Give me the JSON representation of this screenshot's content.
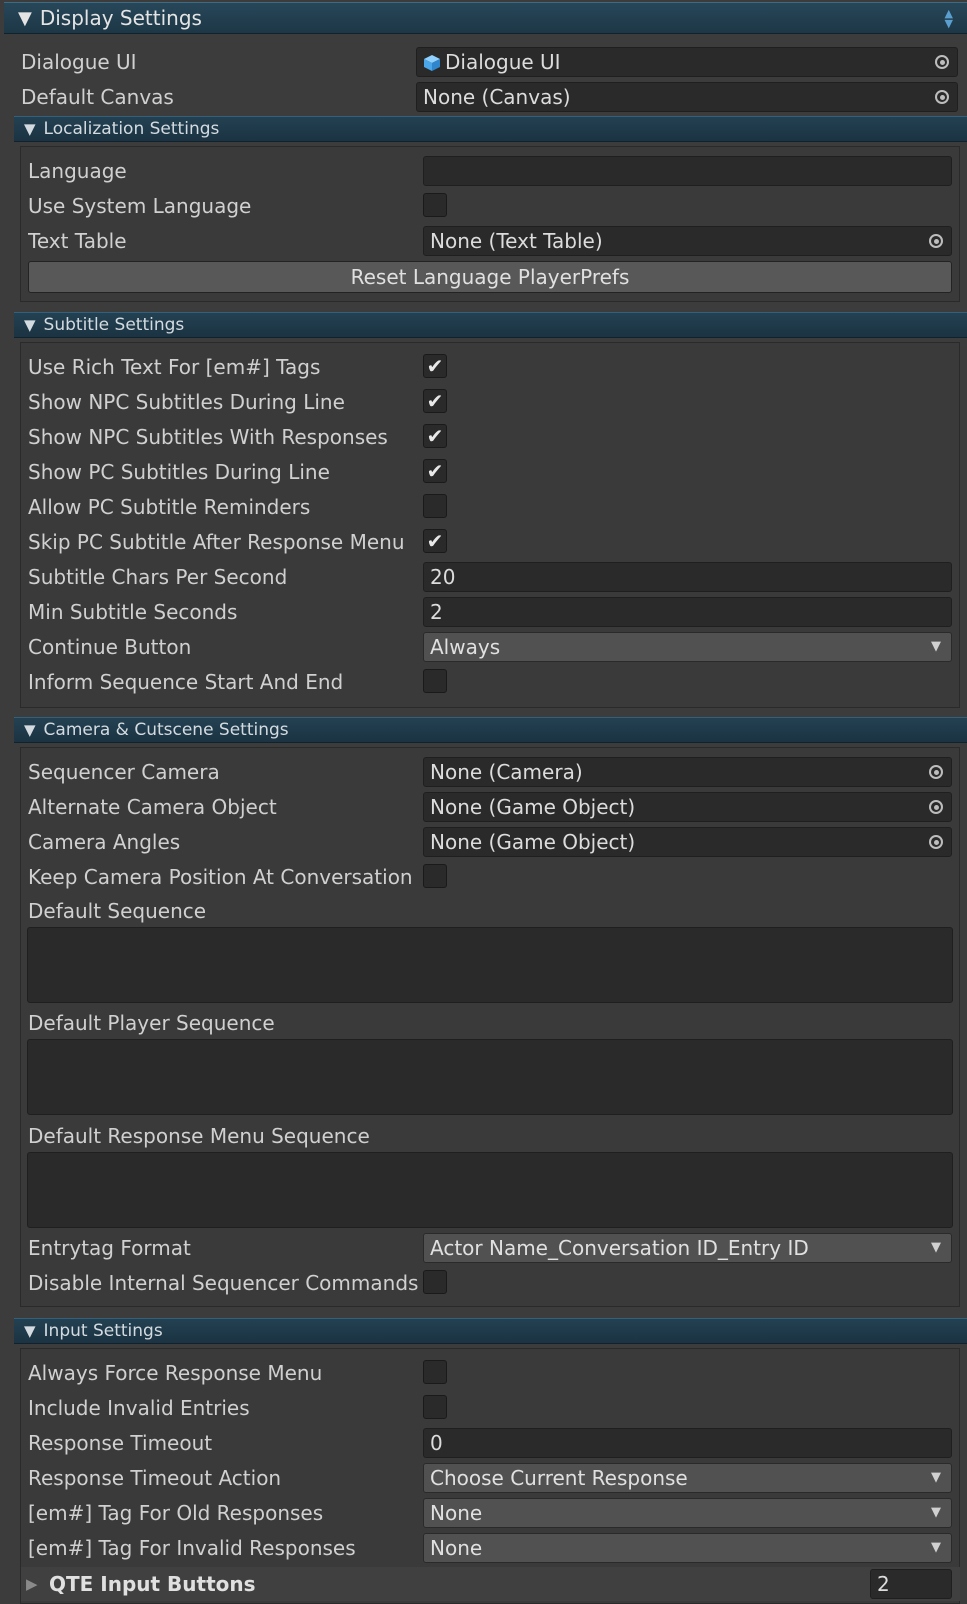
{
  "display_header": "Display Settings",
  "top": {
    "dialogue_ui_label": "Dialogue UI",
    "dialogue_ui_value": "Dialogue UI",
    "default_canvas_label": "Default Canvas",
    "default_canvas_value": "None (Canvas)"
  },
  "localization": {
    "header": "Localization Settings",
    "language_label": "Language",
    "language_value": "",
    "use_system_language_label": "Use System Language",
    "use_system_language": false,
    "text_table_label": "Text Table",
    "text_table_value": "None (Text Table)",
    "reset_button": "Reset Language PlayerPrefs"
  },
  "subtitle": {
    "header": "Subtitle Settings",
    "rows": [
      {
        "label": "Use Rich Text For [em#] Tags",
        "checked": true
      },
      {
        "label": "Show NPC Subtitles During Line",
        "checked": true
      },
      {
        "label": "Show NPC Subtitles With Responses",
        "checked": true
      },
      {
        "label": "Show PC Subtitles During Line",
        "checked": true
      },
      {
        "label": "Allow PC Subtitle Reminders",
        "checked": false
      },
      {
        "label": "Skip PC Subtitle After Response Menu",
        "checked": true
      }
    ],
    "chars_per_second_label": "Subtitle Chars Per Second",
    "chars_per_second": "20",
    "min_seconds_label": "Min Subtitle Seconds",
    "min_seconds": "2",
    "continue_button_label": "Continue Button",
    "continue_button_value": "Always",
    "inform_sequence_label": "Inform Sequence Start And End",
    "inform_sequence": false
  },
  "camera": {
    "header": "Camera & Cutscene Settings",
    "sequencer_camera_label": "Sequencer Camera",
    "sequencer_camera_value": "None (Camera)",
    "alternate_camera_label": "Alternate Camera Object",
    "alternate_camera_value": "None (Game Object)",
    "camera_angles_label": "Camera Angles",
    "camera_angles_value": "None (Game Object)",
    "keep_camera_label": "Keep Camera Position At Conversation End",
    "keep_camera": false,
    "default_sequence_label": "Default Sequence",
    "default_sequence_value": "",
    "default_player_sequence_label": "Default Player Sequence",
    "default_player_sequence_value": "",
    "default_response_menu_sequence_label": "Default Response Menu Sequence",
    "default_response_menu_sequence_value": "",
    "entrytag_format_label": "Entrytag Format",
    "entrytag_format_value": "Actor Name_Conversation ID_Entry ID",
    "disable_internal_label": "Disable Internal Sequencer Commands",
    "disable_internal": false
  },
  "input": {
    "header": "Input Settings",
    "always_force_label": "Always Force Response Menu",
    "always_force": false,
    "include_invalid_label": "Include Invalid Entries",
    "include_invalid": false,
    "response_timeout_label": "Response Timeout",
    "response_timeout": "0",
    "response_timeout_action_label": "Response Timeout Action",
    "response_timeout_action_value": "Choose Current Response",
    "tag_old_label": "[em#] Tag For Old Responses",
    "tag_old_value": "None",
    "tag_invalid_label": "[em#] Tag For Invalid Responses",
    "tag_invalid_value": "None",
    "qte_label": "QTE Input Buttons",
    "qte_count": "2"
  },
  "icons": {
    "picker": "object-picker-icon",
    "cube": "prefab-cube-icon",
    "fold_open": "▼",
    "fold_closed": "▶",
    "check": "✔",
    "dropdown": "▼"
  }
}
